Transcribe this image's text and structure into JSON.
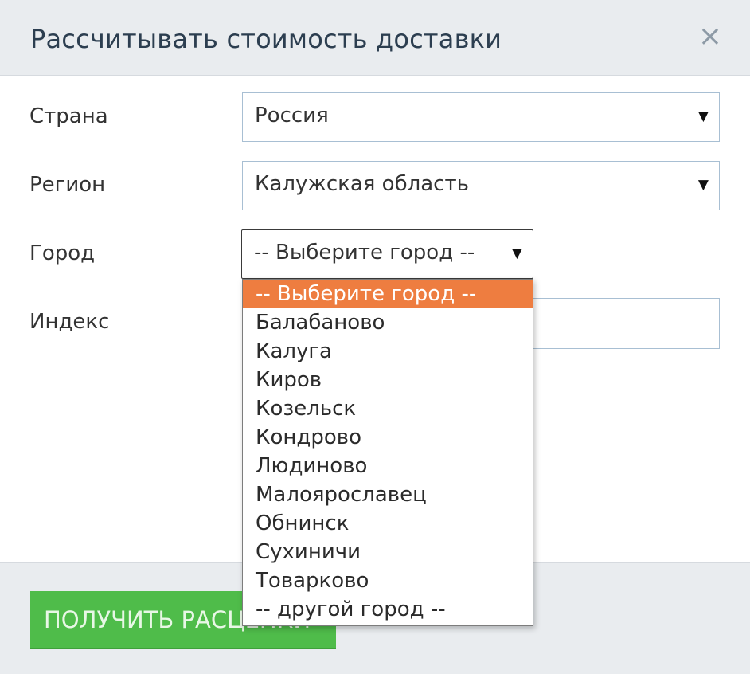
{
  "modal": {
    "title": "Рассчитывать стоимость доставки",
    "close_symbol": "×",
    "close_icon": "close-icon"
  },
  "form": {
    "country": {
      "label": "Страна",
      "value": "Россия"
    },
    "region": {
      "label": "Регион",
      "value": "Калужская область"
    },
    "city": {
      "label": "Город",
      "value": "-- Выберите город --",
      "dropdown_open": true,
      "options": [
        "-- Выберите город --",
        "Балабаново",
        "Калуга",
        "Киров",
        "Козельск",
        "Кондрово",
        "Людиново",
        "Малоярославец",
        "Обнинск",
        "Сухиничи",
        "Товарково",
        "-- другой город --"
      ],
      "highlighted_option": "-- Выберите город --"
    },
    "index": {
      "label": "Индекс",
      "value": ""
    },
    "caret_symbol": "▼"
  },
  "footer": {
    "submit_label": "ПОЛУЧИТЬ РАСЦЕНКИ"
  },
  "colors": {
    "header_bg": "#e9ecef",
    "title_text": "#2c3e50",
    "submit_button": "#4fbc4a",
    "highlight_option": "#ee7d40",
    "input_border": "#a8bfd3"
  }
}
